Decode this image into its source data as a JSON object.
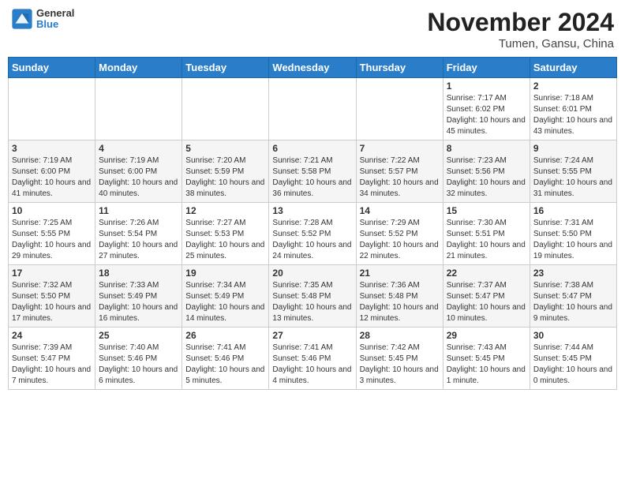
{
  "header": {
    "logo_line1": "General",
    "logo_line2": "Blue",
    "title": "November 2024",
    "subtitle": "Tumen, Gansu, China"
  },
  "weekdays": [
    "Sunday",
    "Monday",
    "Tuesday",
    "Wednesday",
    "Thursday",
    "Friday",
    "Saturday"
  ],
  "weeks": [
    [
      {
        "day": "",
        "info": ""
      },
      {
        "day": "",
        "info": ""
      },
      {
        "day": "",
        "info": ""
      },
      {
        "day": "",
        "info": ""
      },
      {
        "day": "",
        "info": ""
      },
      {
        "day": "1",
        "info": "Sunrise: 7:17 AM\nSunset: 6:02 PM\nDaylight: 10 hours and 45 minutes."
      },
      {
        "day": "2",
        "info": "Sunrise: 7:18 AM\nSunset: 6:01 PM\nDaylight: 10 hours and 43 minutes."
      }
    ],
    [
      {
        "day": "3",
        "info": "Sunrise: 7:19 AM\nSunset: 6:00 PM\nDaylight: 10 hours and 41 minutes."
      },
      {
        "day": "4",
        "info": "Sunrise: 7:19 AM\nSunset: 6:00 PM\nDaylight: 10 hours and 40 minutes."
      },
      {
        "day": "5",
        "info": "Sunrise: 7:20 AM\nSunset: 5:59 PM\nDaylight: 10 hours and 38 minutes."
      },
      {
        "day": "6",
        "info": "Sunrise: 7:21 AM\nSunset: 5:58 PM\nDaylight: 10 hours and 36 minutes."
      },
      {
        "day": "7",
        "info": "Sunrise: 7:22 AM\nSunset: 5:57 PM\nDaylight: 10 hours and 34 minutes."
      },
      {
        "day": "8",
        "info": "Sunrise: 7:23 AM\nSunset: 5:56 PM\nDaylight: 10 hours and 32 minutes."
      },
      {
        "day": "9",
        "info": "Sunrise: 7:24 AM\nSunset: 5:55 PM\nDaylight: 10 hours and 31 minutes."
      }
    ],
    [
      {
        "day": "10",
        "info": "Sunrise: 7:25 AM\nSunset: 5:55 PM\nDaylight: 10 hours and 29 minutes."
      },
      {
        "day": "11",
        "info": "Sunrise: 7:26 AM\nSunset: 5:54 PM\nDaylight: 10 hours and 27 minutes."
      },
      {
        "day": "12",
        "info": "Sunrise: 7:27 AM\nSunset: 5:53 PM\nDaylight: 10 hours and 25 minutes."
      },
      {
        "day": "13",
        "info": "Sunrise: 7:28 AM\nSunset: 5:52 PM\nDaylight: 10 hours and 24 minutes."
      },
      {
        "day": "14",
        "info": "Sunrise: 7:29 AM\nSunset: 5:52 PM\nDaylight: 10 hours and 22 minutes."
      },
      {
        "day": "15",
        "info": "Sunrise: 7:30 AM\nSunset: 5:51 PM\nDaylight: 10 hours and 21 minutes."
      },
      {
        "day": "16",
        "info": "Sunrise: 7:31 AM\nSunset: 5:50 PM\nDaylight: 10 hours and 19 minutes."
      }
    ],
    [
      {
        "day": "17",
        "info": "Sunrise: 7:32 AM\nSunset: 5:50 PM\nDaylight: 10 hours and 17 minutes."
      },
      {
        "day": "18",
        "info": "Sunrise: 7:33 AM\nSunset: 5:49 PM\nDaylight: 10 hours and 16 minutes."
      },
      {
        "day": "19",
        "info": "Sunrise: 7:34 AM\nSunset: 5:49 PM\nDaylight: 10 hours and 14 minutes."
      },
      {
        "day": "20",
        "info": "Sunrise: 7:35 AM\nSunset: 5:48 PM\nDaylight: 10 hours and 13 minutes."
      },
      {
        "day": "21",
        "info": "Sunrise: 7:36 AM\nSunset: 5:48 PM\nDaylight: 10 hours and 12 minutes."
      },
      {
        "day": "22",
        "info": "Sunrise: 7:37 AM\nSunset: 5:47 PM\nDaylight: 10 hours and 10 minutes."
      },
      {
        "day": "23",
        "info": "Sunrise: 7:38 AM\nSunset: 5:47 PM\nDaylight: 10 hours and 9 minutes."
      }
    ],
    [
      {
        "day": "24",
        "info": "Sunrise: 7:39 AM\nSunset: 5:47 PM\nDaylight: 10 hours and 7 minutes."
      },
      {
        "day": "25",
        "info": "Sunrise: 7:40 AM\nSunset: 5:46 PM\nDaylight: 10 hours and 6 minutes."
      },
      {
        "day": "26",
        "info": "Sunrise: 7:41 AM\nSunset: 5:46 PM\nDaylight: 10 hours and 5 minutes."
      },
      {
        "day": "27",
        "info": "Sunrise: 7:41 AM\nSunset: 5:46 PM\nDaylight: 10 hours and 4 minutes."
      },
      {
        "day": "28",
        "info": "Sunrise: 7:42 AM\nSunset: 5:45 PM\nDaylight: 10 hours and 3 minutes."
      },
      {
        "day": "29",
        "info": "Sunrise: 7:43 AM\nSunset: 5:45 PM\nDaylight: 10 hours and 1 minute."
      },
      {
        "day": "30",
        "info": "Sunrise: 7:44 AM\nSunset: 5:45 PM\nDaylight: 10 hours and 0 minutes."
      }
    ]
  ]
}
